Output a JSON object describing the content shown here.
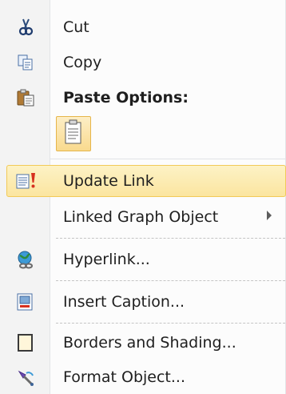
{
  "menu": {
    "cut": {
      "label": "Cut",
      "icon": "scissors-icon"
    },
    "copy": {
      "label": "Copy",
      "icon": "copy-icon"
    },
    "paste_options": {
      "label": "Paste Options:",
      "icon": "clipboard-icon"
    },
    "paste_keep_text_only": {
      "icon": "paste-text-only-icon"
    },
    "update_link": {
      "label": "Update Link",
      "icon": "update-link-icon",
      "highlighted": true
    },
    "linked_graph_object": {
      "label": "Linked Graph Object",
      "has_submenu": true
    },
    "hyperlink": {
      "label": "Hyperlink...",
      "icon": "globe-link-icon"
    },
    "insert_caption": {
      "label": "Insert Caption...",
      "icon": "caption-icon"
    },
    "borders_and_shading": {
      "label": "Borders and Shading...",
      "icon": "border-icon"
    },
    "format_object": {
      "label": "Format Object...",
      "icon": "format-brush-icon"
    }
  },
  "colors": {
    "highlight_fill": "#fbe5a0",
    "highlight_border": "#f2ca58",
    "gutter": "#f3f3f3"
  }
}
